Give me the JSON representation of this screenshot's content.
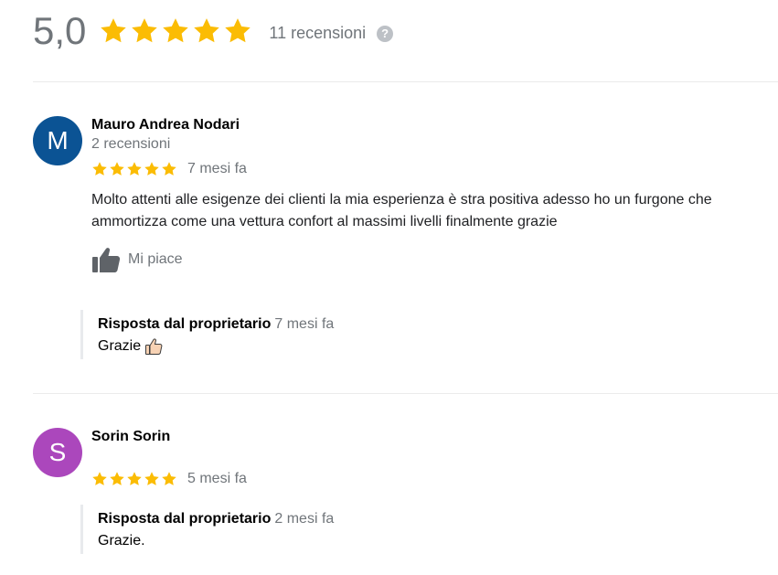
{
  "summary": {
    "rating": "5,0",
    "stars": 5,
    "review_count": "11 recensioni",
    "help_icon": "?"
  },
  "colors": {
    "star": "#fbbc04",
    "avatar_m": "#0b5394",
    "avatar_s": "#ab47bc",
    "muted": "#70757a",
    "divider": "#ebebeb"
  },
  "reviews": [
    {
      "avatar_letter": "M",
      "author": "Mauro Andrea Nodari",
      "author_reviews": "2 recensioni",
      "stars": 5,
      "date": "7 mesi fa",
      "text_line1": "Molto attenti alle esigenze dei clienti la mia esperienza è stra positiva adesso ho un furgone che",
      "text_line2": "ammortizza come una vettura confort al massimi livelli finalmente grazie",
      "like_label": "Mi piace",
      "like_icon": "thumbs-up-icon",
      "reply": {
        "title": "Risposta dal proprietario",
        "date": "7 mesi fa",
        "text": "Grazie",
        "emoji_icon": "thumbs-up-emoji-icon"
      }
    },
    {
      "avatar_letter": "S",
      "author": "Sorin Sorin",
      "stars": 5,
      "date": "5 mesi fa",
      "reply": {
        "title": "Risposta dal proprietario",
        "date": "2 mesi fa",
        "text": "Grazie."
      }
    }
  ]
}
